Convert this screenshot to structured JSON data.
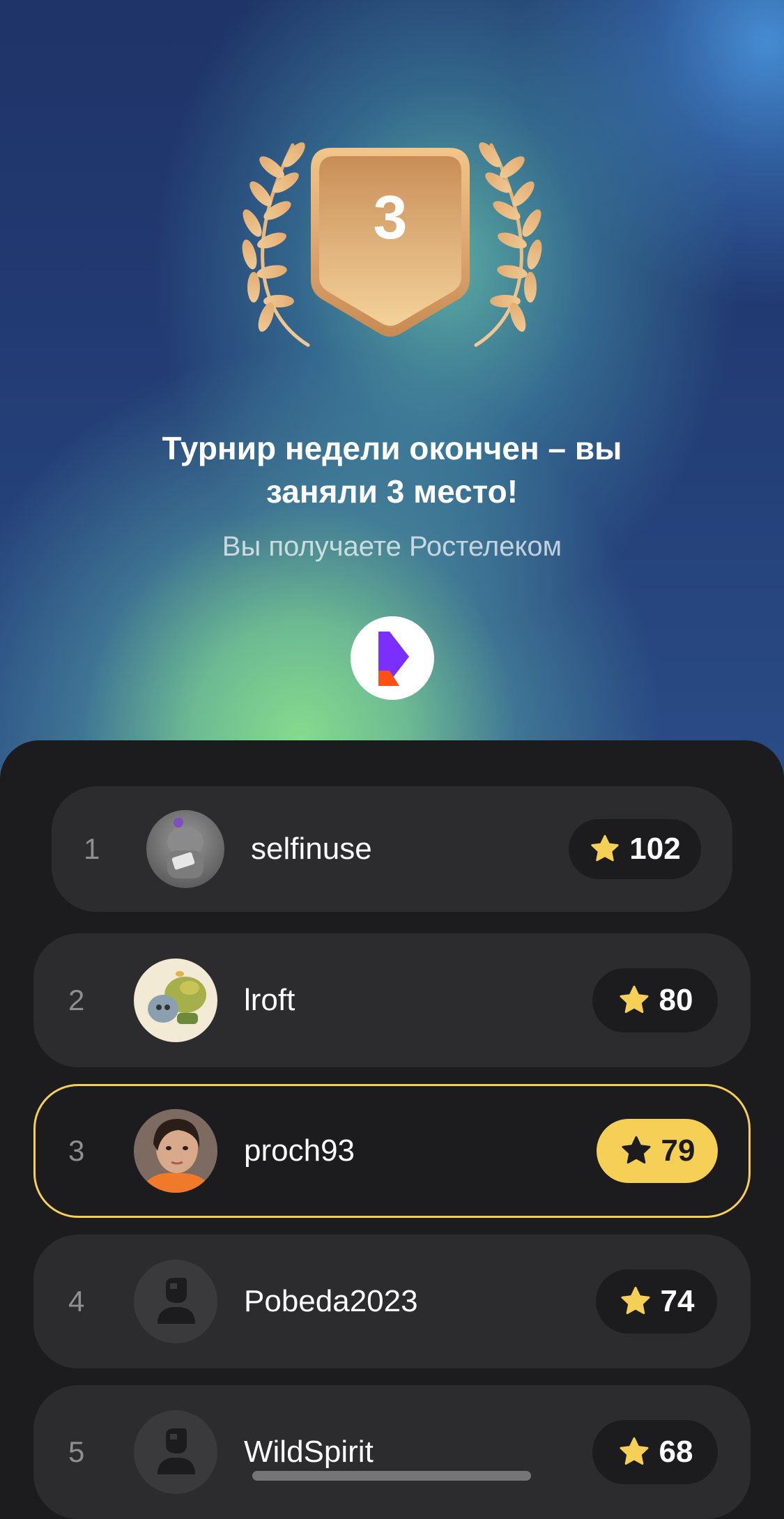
{
  "result": {
    "place": "3",
    "title_line1": "Турнир недели окончен – вы",
    "title_line2": "заняли 3 место!",
    "subtitle": "Вы получаете Ростелеком",
    "partner_icon": "rostelecom-logo-icon"
  },
  "colors": {
    "bronze": "#d6a06a",
    "highlight": "#f6cf57",
    "sheet_bg": "#1c1c1e",
    "row_bg": "#2c2c2e",
    "logo_violet": "#7b2fff",
    "logo_orange": "#ff4f12"
  },
  "leaderboard": [
    {
      "rank": "1",
      "username": "selfinuse",
      "score": "102",
      "avatar": "photo-avatar-icon"
    },
    {
      "rank": "2",
      "username": "lroft",
      "score": "80",
      "avatar": "illustration-avatar-icon"
    },
    {
      "rank": "3",
      "username": "proch93",
      "score": "79",
      "avatar": "photo-avatar-icon",
      "current_user": true
    },
    {
      "rank": "4",
      "username": "Pobeda2023",
      "score": "74",
      "avatar": "default-avatar-icon"
    },
    {
      "rank": "5",
      "username": "WildSpirit",
      "score": "68",
      "avatar": "default-avatar-icon"
    }
  ]
}
